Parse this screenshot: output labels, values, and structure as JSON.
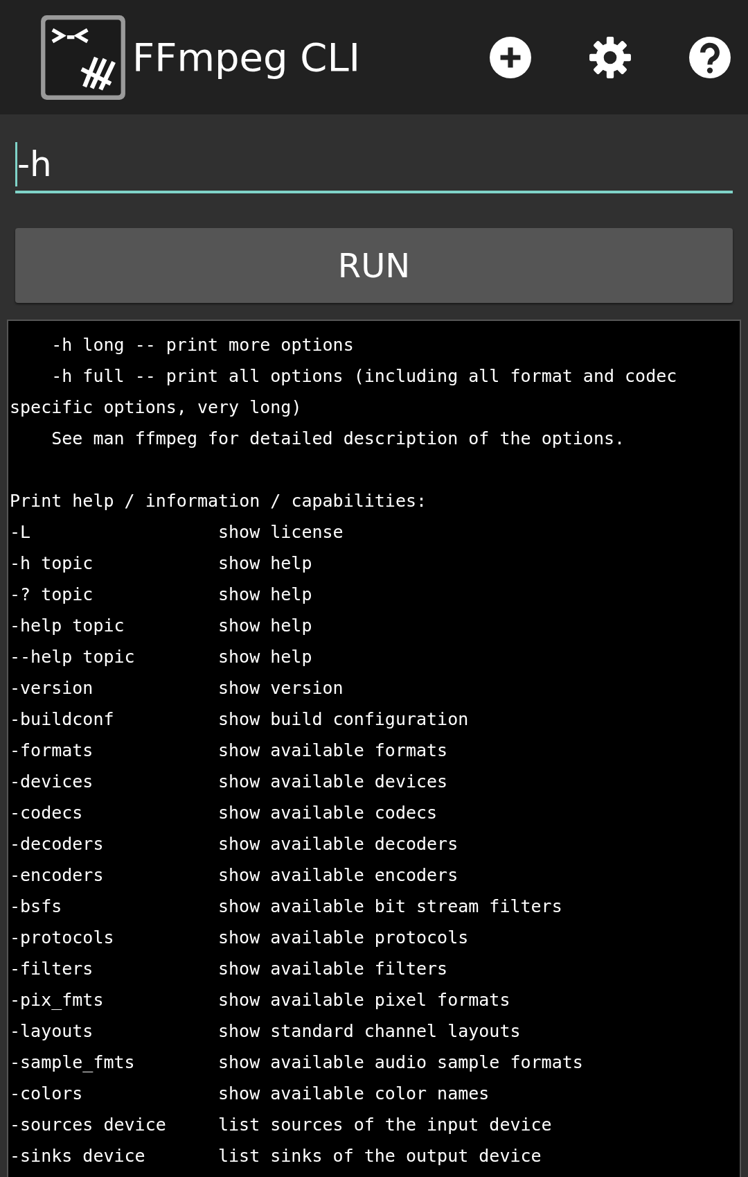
{
  "app_bar": {
    "title": "FFmpeg CLI"
  },
  "command": {
    "value": "-h"
  },
  "run_button": {
    "label": "RUN"
  },
  "output": {
    "intro_lines": [
      "    -h long -- print more options",
      "    -h full -- print all options (including all format and codec specific options, very long)",
      "    See man ffmpeg for detailed description of the options."
    ],
    "section_title": "Print help / information / capabilities:",
    "options": [
      {
        "option": "-L",
        "description": "show license"
      },
      {
        "option": "-h topic",
        "description": "show help"
      },
      {
        "option": "-? topic",
        "description": "show help"
      },
      {
        "option": "-help topic",
        "description": "show help"
      },
      {
        "option": "--help topic",
        "description": "show help"
      },
      {
        "option": "-version",
        "description": "show version"
      },
      {
        "option": "-buildconf",
        "description": "show build configuration"
      },
      {
        "option": "-formats",
        "description": "show available formats"
      },
      {
        "option": "-devices",
        "description": "show available devices"
      },
      {
        "option": "-codecs",
        "description": "show available codecs"
      },
      {
        "option": "-decoders",
        "description": "show available decoders"
      },
      {
        "option": "-encoders",
        "description": "show available encoders"
      },
      {
        "option": "-bsfs",
        "description": "show available bit stream filters"
      },
      {
        "option": "-protocols",
        "description": "show available protocols"
      },
      {
        "option": "-filters",
        "description": "show available filters"
      },
      {
        "option": "-pix_fmts",
        "description": "show available pixel formats"
      },
      {
        "option": "-layouts",
        "description": "show standard channel layouts"
      },
      {
        "option": "-sample_fmts",
        "description": "show available audio sample formats"
      },
      {
        "option": "-colors",
        "description": "show available color names"
      },
      {
        "option": "-sources device",
        "description": "list sources of the input device"
      },
      {
        "option": "-sinks device",
        "description": "list sinks of the output device"
      }
    ]
  }
}
